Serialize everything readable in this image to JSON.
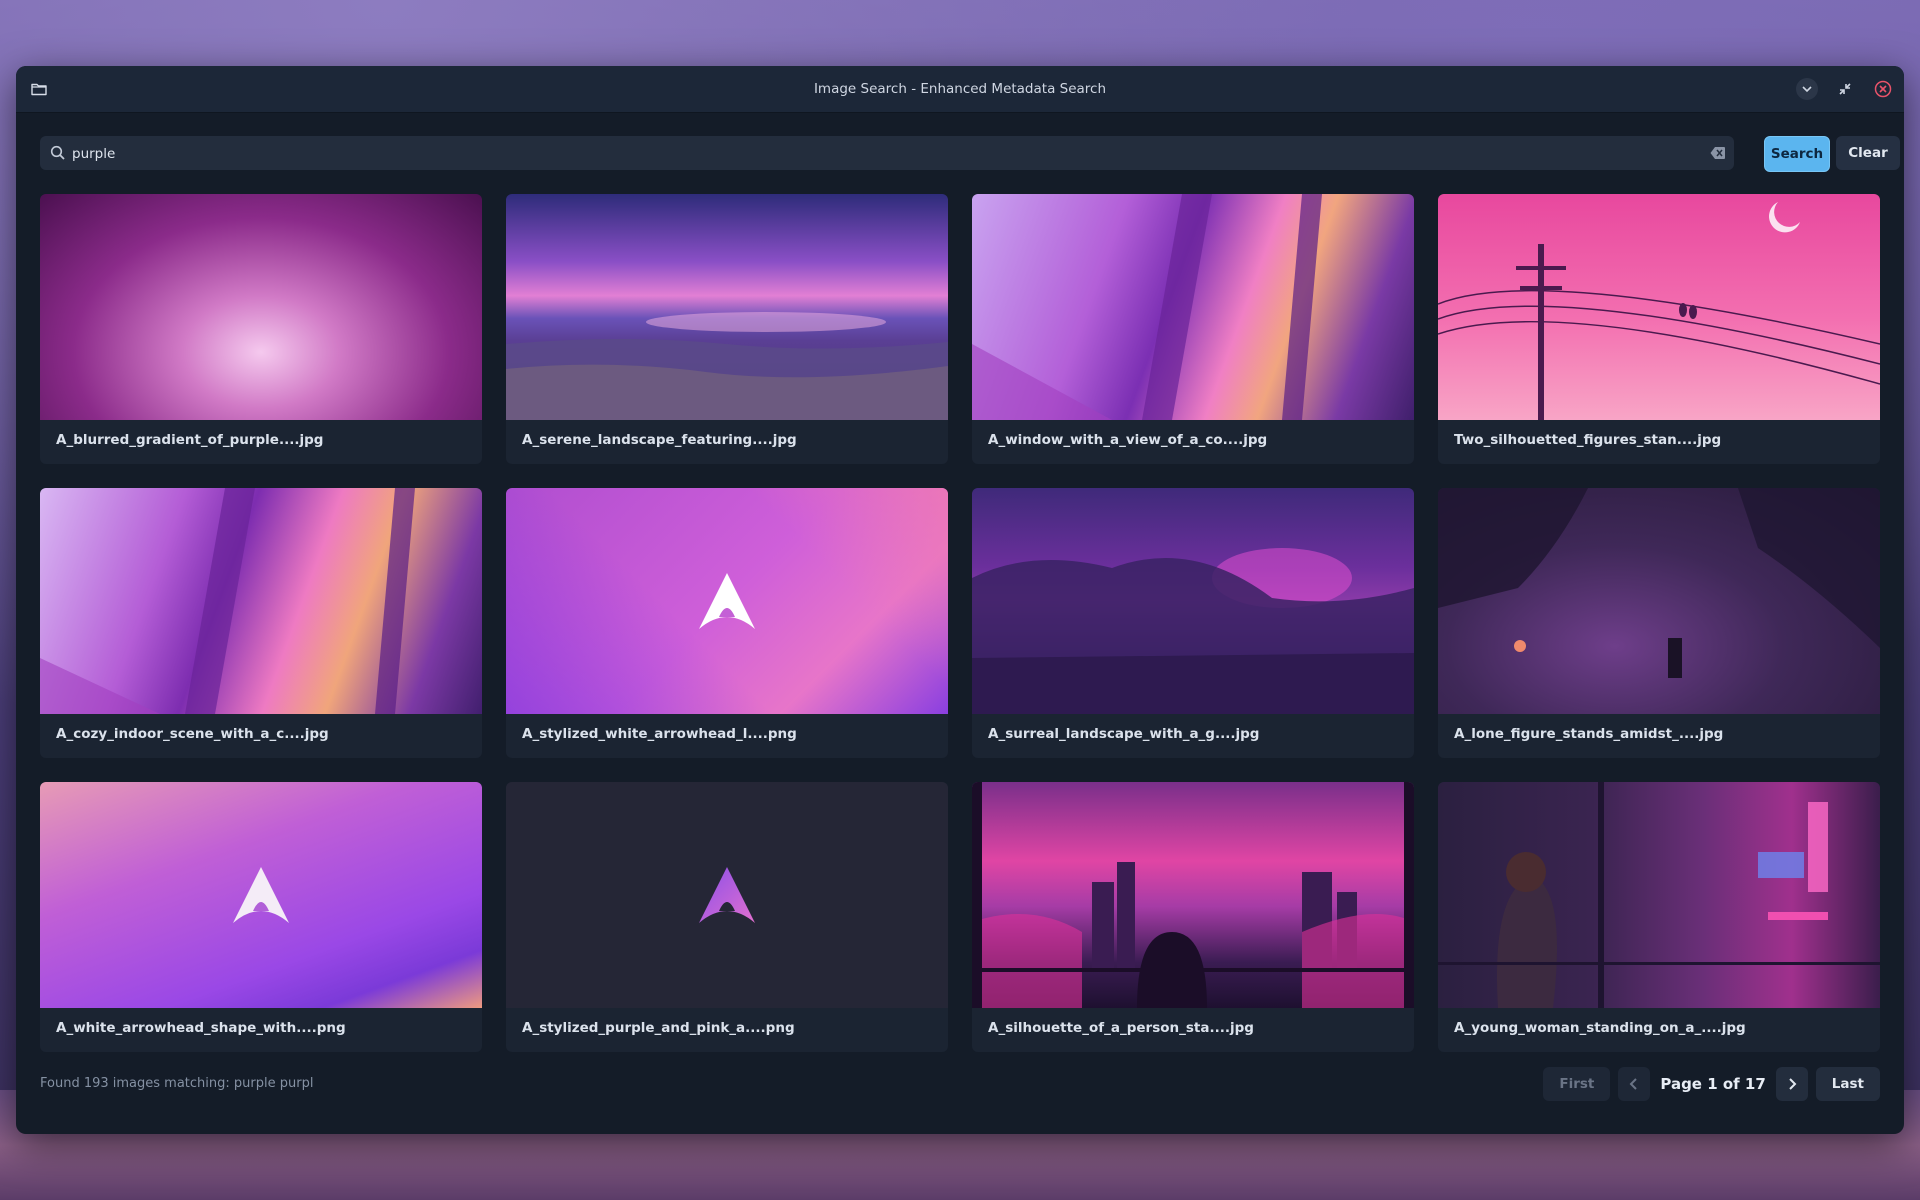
{
  "window": {
    "title": "Image Search - Enhanced Metadata Search"
  },
  "search": {
    "value": "purple",
    "search_label": "Search",
    "clear_label": "Clear"
  },
  "results": [
    {
      "filename": "A_blurred_gradient_of_purple....jpg"
    },
    {
      "filename": "A_serene_landscape_featuring....jpg"
    },
    {
      "filename": "A_window_with_a_view_of_a_co....jpg"
    },
    {
      "filename": "Two_silhouetted_figures_stan....jpg"
    },
    {
      "filename": "A_cozy_indoor_scene_with_a_c....jpg"
    },
    {
      "filename": "A_stylized_white_arrowhead_l....png"
    },
    {
      "filename": "A_surreal_landscape_with_a_g....jpg"
    },
    {
      "filename": "A_lone_figure_stands_amidst_....jpg"
    },
    {
      "filename": "A_white_arrowhead_shape_with....png"
    },
    {
      "filename": "A_stylized_purple_and_pink_a....png"
    },
    {
      "filename": "A_silhouette_of_a_person_sta....jpg"
    },
    {
      "filename": "A_young_woman_standing_on_a_....jpg"
    }
  ],
  "footer": {
    "status": "Found 193 images matching: purple purpl",
    "first_label": "First",
    "page_label": "Page 1 of 17",
    "last_label": "Last"
  }
}
